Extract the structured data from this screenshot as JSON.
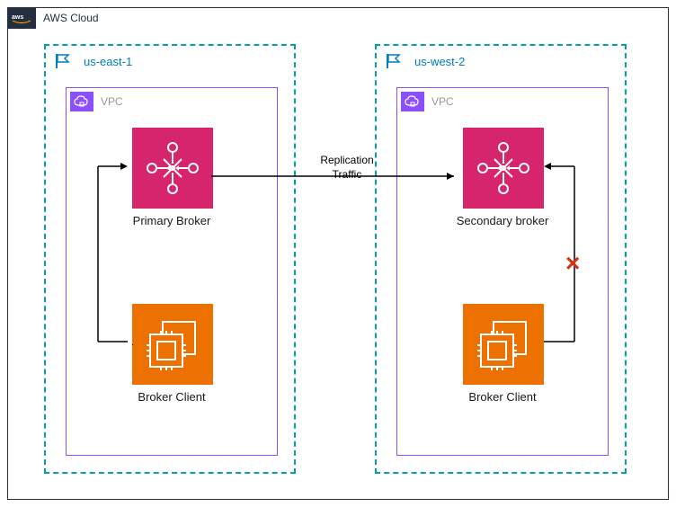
{
  "cloud": {
    "label": "AWS Cloud",
    "icon_name": "aws"
  },
  "regions": [
    {
      "id": "east",
      "label": "us-east-1"
    },
    {
      "id": "west",
      "label": "us-west-2"
    }
  ],
  "vpc": {
    "label": "VPC"
  },
  "brokers": [
    {
      "id": "primary",
      "label": "Primary Broker"
    },
    {
      "id": "secondary",
      "label": "Secondary broker"
    }
  ],
  "client": {
    "label": "Broker Client"
  },
  "replication": {
    "label": "Replication\nTraffic"
  },
  "connection_blocked": {
    "symbol": "×"
  }
}
